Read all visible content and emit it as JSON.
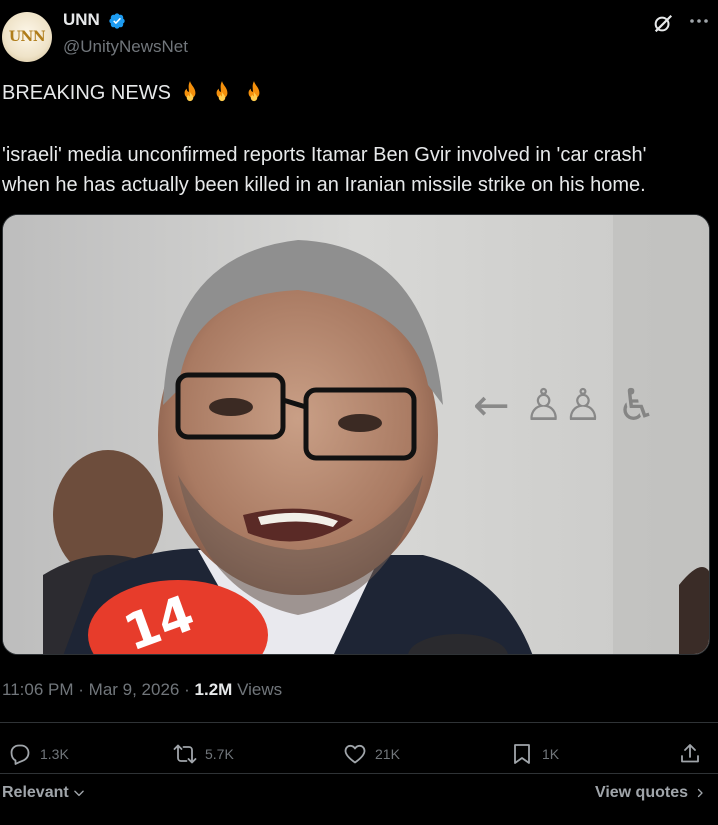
{
  "author": {
    "name": "UNN",
    "handle": "@UnityNewsNet",
    "avatar_text": "UNN"
  },
  "post": {
    "headline": "BREAKING NEWS",
    "headline_emoji": [
      "fire-icon",
      "fire-icon",
      "fire-icon"
    ],
    "body_line1": "'israeli' media unconfirmed reports Itamar Ben Gvir involved in 'car crash'",
    "body_line2": "when he has actually been killed in an Iranian missile strike on his home."
  },
  "media": {
    "sign_text": "← 🚹🚺 ♿",
    "mic_text": "14"
  },
  "meta": {
    "time": "11:06 PM",
    "separator": "·",
    "date": "Mar 9, 2026",
    "views_count": "1.2M",
    "views_label": "Views"
  },
  "actions": {
    "replies": "1.3K",
    "reposts": "5.7K",
    "likes": "21K",
    "bookmarks": "1K"
  },
  "footer": {
    "sort_label": "Relevant",
    "view_quotes_label": "View quotes"
  },
  "colors": {
    "background": "#000000",
    "text_primary": "#e7e9ea",
    "text_secondary": "#71767b",
    "verified_blue": "#1d9bf0",
    "divider": "#2f3336"
  }
}
